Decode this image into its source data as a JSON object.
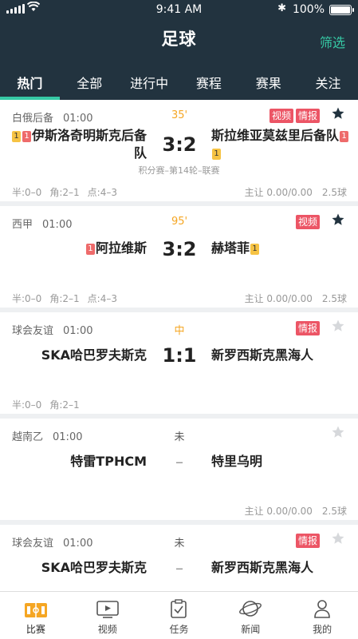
{
  "status_bar": {
    "time": "9:41 AM",
    "battery": "100%"
  },
  "header": {
    "title": "足球",
    "filter": "筛选"
  },
  "tabs": [
    {
      "label": "热门",
      "active": true
    },
    {
      "label": "全部",
      "active": false
    },
    {
      "label": "进行中",
      "active": false
    },
    {
      "label": "赛程",
      "active": false
    },
    {
      "label": "赛果",
      "active": false
    },
    {
      "label": "关注",
      "active": false
    }
  ],
  "matches": [
    {
      "league": "白俄后备",
      "time": "01:00",
      "status": "35'",
      "badges": [
        "视频",
        "情报"
      ],
      "starred": true,
      "home_cards": [
        "1",
        "1"
      ],
      "home": "伊斯洛奇明斯克后备队",
      "score": "3:2",
      "away": "斯拉维亚莫兹里后备队",
      "away_cards": [
        "1",
        "1"
      ],
      "round": "积分赛–第14轮–联赛",
      "half": "半:0–0",
      "corner": "角:2–1",
      "other": "点:4–3",
      "handicap": "主让 0.00/0.00",
      "total": "2.5球"
    },
    {
      "league": "西甲",
      "time": "01:00",
      "status": "95'",
      "badges": [
        "视频"
      ],
      "starred": true,
      "home_cards": [
        "1"
      ],
      "home": "阿拉维斯",
      "score": "3:2",
      "away": "赫塔菲",
      "away_cards": [
        "1"
      ],
      "half": "半:0–0",
      "corner": "角:2–1",
      "other": "点:4–3",
      "handicap": "主让 0.00/0.00",
      "total": "2.5球"
    },
    {
      "league": "球会友谊",
      "time": "01:00",
      "status": "中",
      "badges": [
        "情报"
      ],
      "starred": false,
      "home": "SKA哈巴罗夫斯克",
      "score": "1:1",
      "away": "新罗西斯克黑海人",
      "half": "半:0–0",
      "corner": "角:2–1"
    },
    {
      "league": "越南乙",
      "time": "01:00",
      "status": "未",
      "badges": [],
      "starred": false,
      "home": "特雷TPHCM",
      "score": "–",
      "away": "特里乌明",
      "handicap": "主让 0.00/0.00",
      "total": "2.5球"
    },
    {
      "league": "球会友谊",
      "time": "01:00",
      "status": "未",
      "badges": [
        "情报"
      ],
      "starred": false,
      "home": "SKA哈巴罗夫斯克",
      "score": "–",
      "away": "新罗西斯克黑海人"
    }
  ],
  "tabbar": [
    {
      "label": "比赛",
      "icon": "match-icon",
      "active": true
    },
    {
      "label": "视频",
      "icon": "video-icon",
      "active": false
    },
    {
      "label": "任务",
      "icon": "task-icon",
      "active": false
    },
    {
      "label": "新闻",
      "icon": "news-icon",
      "active": false
    },
    {
      "label": "我的",
      "icon": "profile-icon",
      "active": false
    }
  ],
  "colors": {
    "header_bg": "#22333f",
    "accent": "#36c9a5",
    "badge": "#ec5565",
    "live": "#f5a623",
    "tab_active": "#f5a623"
  }
}
